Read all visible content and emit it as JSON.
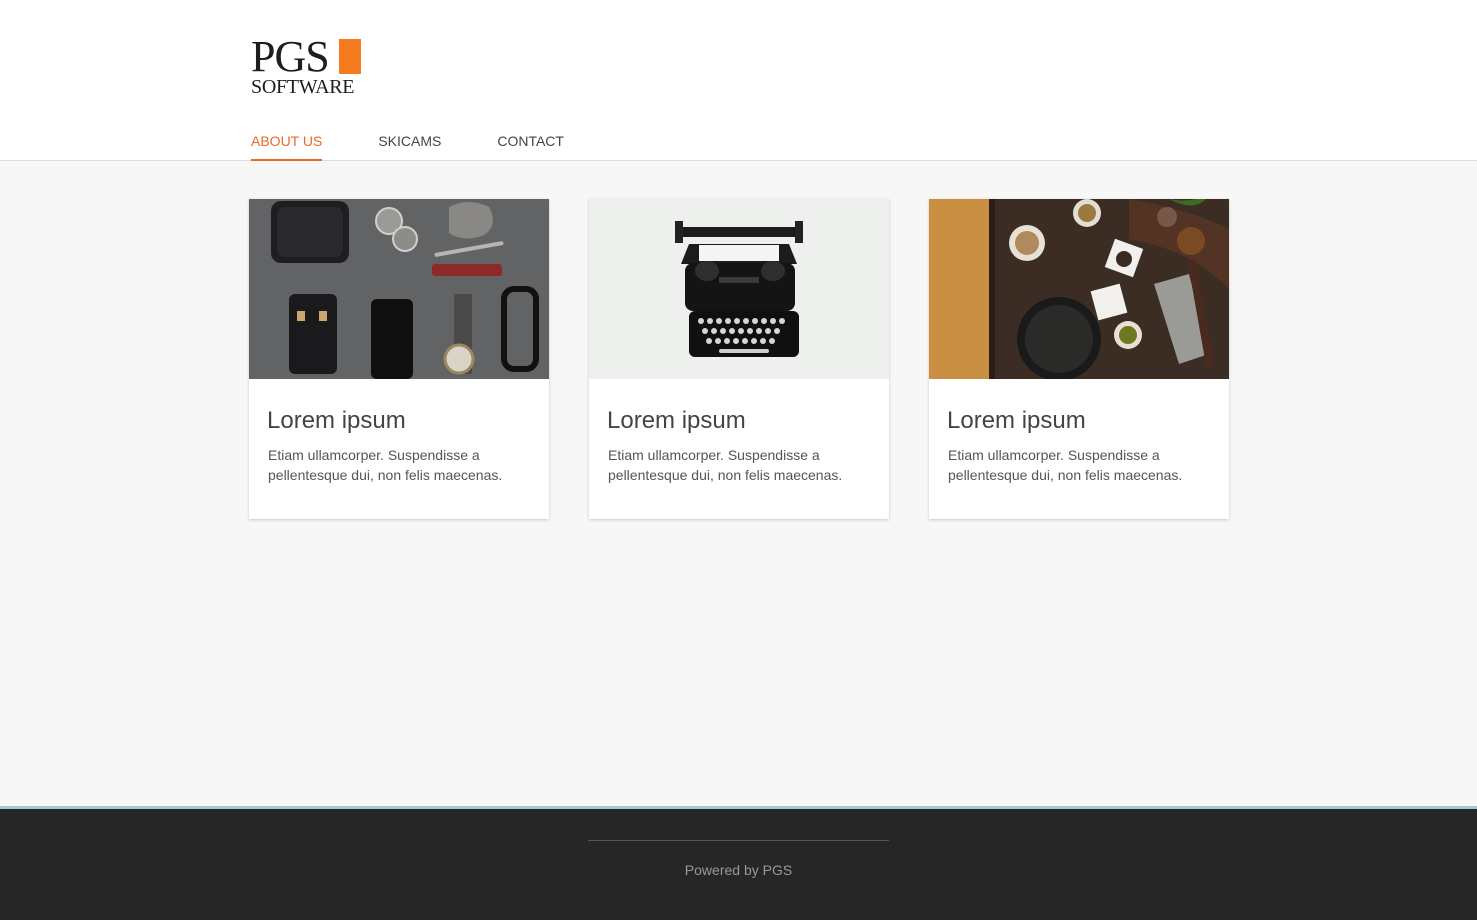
{
  "brand": {
    "line1": "PGS",
    "line2": "SOFTWARE",
    "accent_color": "#f47b20"
  },
  "nav": {
    "items": [
      {
        "label": "ABOUT US",
        "active": true
      },
      {
        "label": "SKICAMS",
        "active": false
      },
      {
        "label": "CONTACT",
        "active": false
      }
    ],
    "active_color": "#e8692c"
  },
  "cards": [
    {
      "title": "Lorem ipsum",
      "text": "Etiam ullamcorper. Suspendisse a pellentesque dui, non felis maecenas.",
      "image": "flat-lay-accessories-photo"
    },
    {
      "title": "Lorem ipsum",
      "text": "Etiam ullamcorper. Suspendisse a pellentesque dui, non felis maecenas.",
      "image": "typewriter-photo"
    },
    {
      "title": "Lorem ipsum",
      "text": "Etiam ullamcorper. Suspendisse a pellentesque dui, non felis maecenas.",
      "image": "kitchen-spices-photo"
    }
  ],
  "footer": {
    "text": "Powered by PGS"
  }
}
